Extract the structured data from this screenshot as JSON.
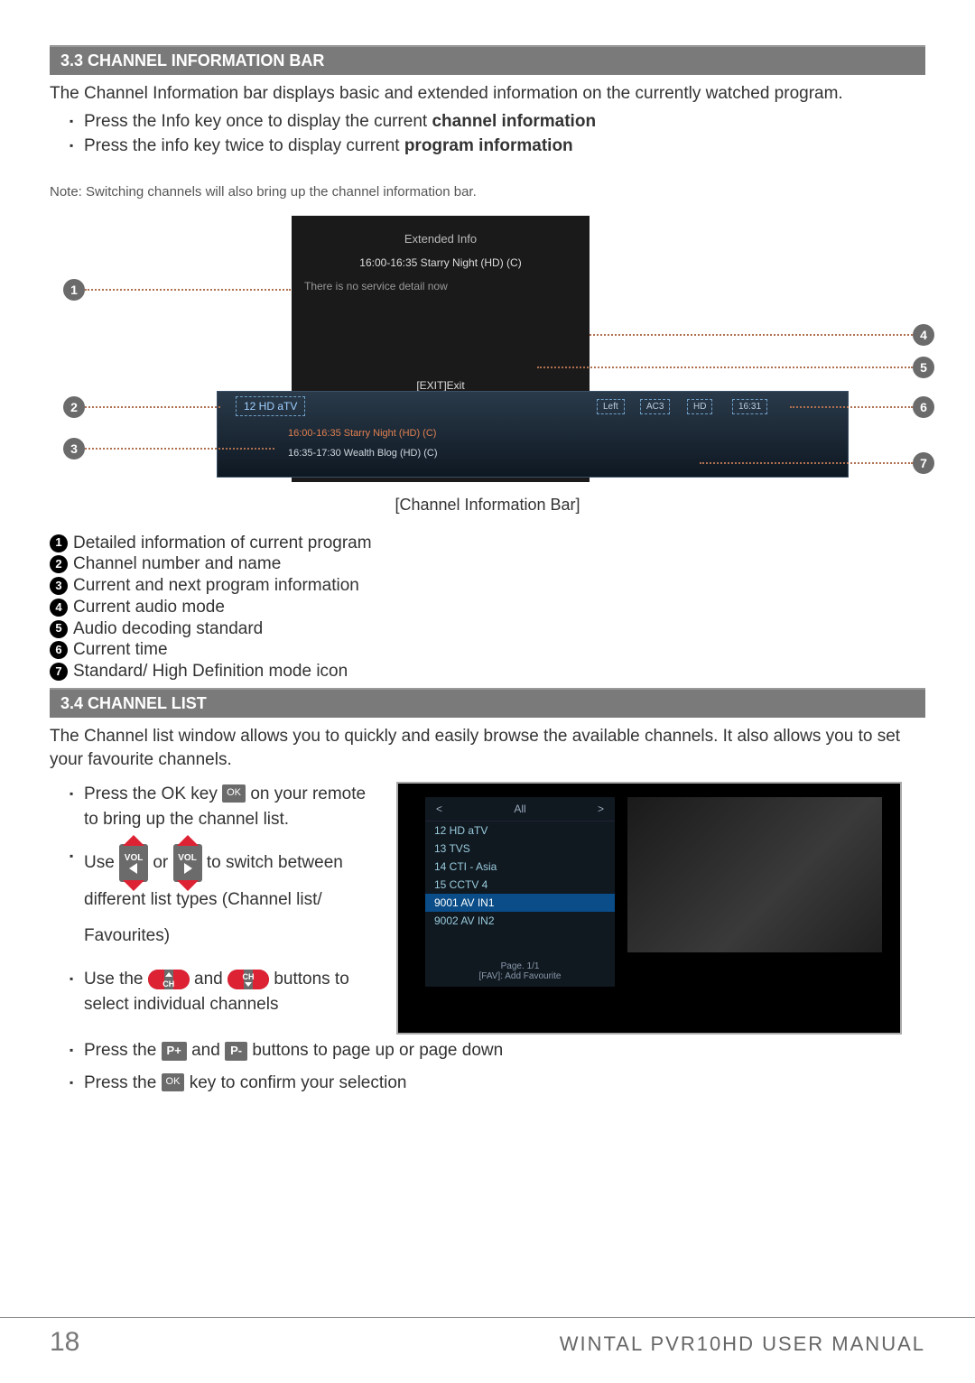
{
  "section33": {
    "heading": "3.3 CHANNEL INFORMATION BAR",
    "intro": "The Channel Information bar displays basic and extended information on the currently watched program.",
    "b1_pre": "Press the Info key once to display the current ",
    "b1_bold": "channel information",
    "b2_pre": "Press the info key twice to display current ",
    "b2_bold": "program information",
    "note": "Note: Switching channels will also bring up the channel information bar.",
    "caption": "[Channel Information Bar]"
  },
  "osd": {
    "title": "Extended Info",
    "line1": "16:00-16:35 Starry Night (HD) (C)",
    "line2": "There is no service detail now",
    "exit": "[EXIT]Exit",
    "chname": "12 HD aTV",
    "prog1": "16:00-16:35   Starry Night (HD) (C)",
    "prog2": "16:35-17:30   Wealth Blog (HD) (C)",
    "tag1": "Left",
    "tag2": "AC3",
    "tag3": "HD",
    "tag4": "16:31"
  },
  "legend": {
    "l1": "Detailed information of current program",
    "l2": "Channel number and name",
    "l3": "Current and next program information",
    "l4": "Current audio mode",
    "l5": "Audio decoding standard",
    "l6": "Current time",
    "l7": "Standard/ High Definition mode icon"
  },
  "section34": {
    "heading": "3.4 CHANNEL LIST",
    "intro": "The Channel list window allows you to quickly and easily browse the available channels. It also allows you to set your favourite channels.",
    "b1a": "Press the OK key ",
    "b1b": " on your remote to bring up the channel list.",
    "b2a": "Use ",
    "b2b": " or ",
    "b2c": " to switch between different list types (Channel list/ Favourites)",
    "b3a": "Use the ",
    "b3b": " and ",
    "b3c": " buttons to select individual channels",
    "b4a": "Press the ",
    "b4b": " and ",
    "b4c": " buttons to page up or page down",
    "b5a": "Press the ",
    "b5b": " key to confirm your selection"
  },
  "buttons": {
    "ok": "OK",
    "vol": "VOL",
    "ch": "CH",
    "pplus": "P+",
    "pminus": "P-"
  },
  "clist": {
    "headL": "<",
    "headC": "All",
    "headR": ">",
    "items": [
      "12  HD aTV",
      "13  TVS",
      "14  CTI - Asia",
      "15  CCTV 4",
      "9001  AV IN1",
      "9002  AV IN2"
    ],
    "page": "Page.  1/1",
    "fav": "[FAV]: Add Favourite"
  },
  "footer": {
    "page": "18",
    "title": "WINTAL PVR10HD USER MANUAL"
  }
}
